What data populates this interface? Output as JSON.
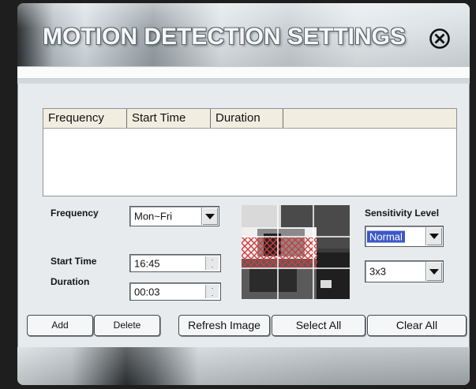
{
  "dialog": {
    "title": "MOTION DETECTION SETTINGS"
  },
  "schedule_table": {
    "columns": [
      "Frequency",
      "Start Time",
      "Duration"
    ],
    "rows": []
  },
  "form": {
    "frequency": {
      "label": "Frequency",
      "value": "Mon~Fri"
    },
    "start_time": {
      "label": "Start Time",
      "value": "16:45"
    },
    "duration": {
      "label": "Duration",
      "value": "00:03"
    },
    "sensitivity": {
      "label": "Sensitivity Level",
      "value": "Normal"
    },
    "grid": {
      "value": "3x3"
    }
  },
  "buttons": {
    "add": "Add",
    "delete": "Delete",
    "refresh_image": "Refresh Image",
    "select_all": "Select All",
    "clear_all": "Clear All"
  },
  "icons": {
    "close": "close-circle-x-icon",
    "dropdown": "chevron-down-icon",
    "spinner": "spinner-arrows-icon"
  },
  "colors": {
    "selection_highlight": "#3b57c9",
    "motion_zone": "#d23a3a",
    "table_header_bg": "#f1ede0"
  }
}
